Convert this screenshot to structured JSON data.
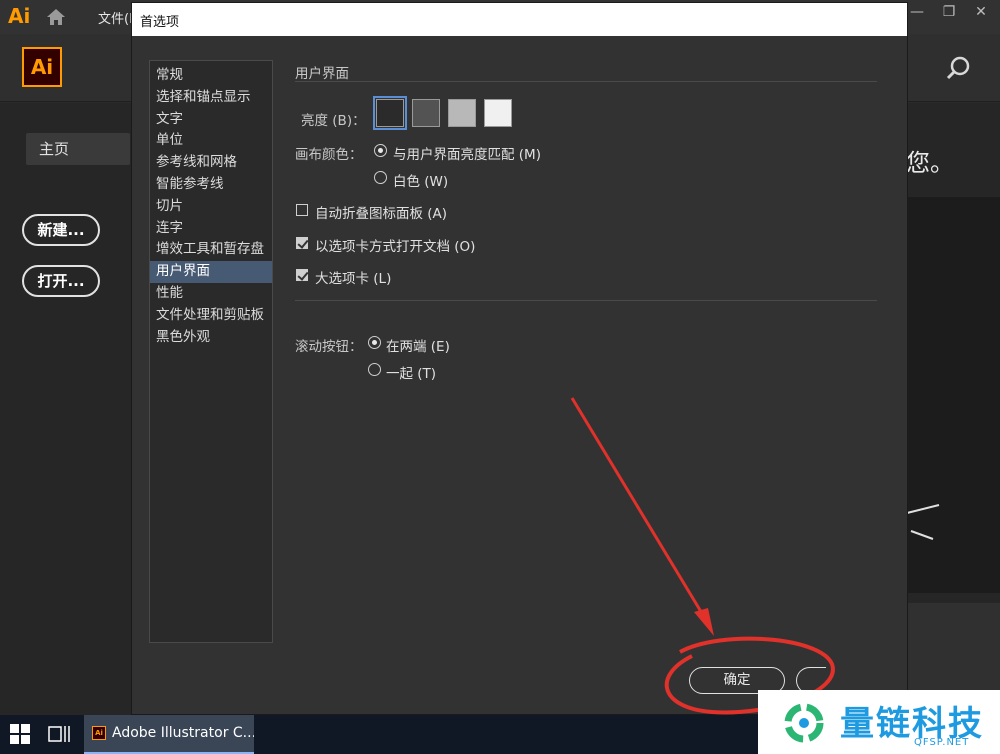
{
  "app": {
    "small_logo": "Ai",
    "menu_file": "文件(F)",
    "logo": "Ai",
    "home_tab": "主页",
    "new_button": "新建...",
    "open_button": "打开...",
    "right_partial_text": "您。"
  },
  "dialog": {
    "title": "首选项",
    "categories": [
      "常规",
      "选择和锚点显示",
      "文字",
      "单位",
      "参考线和网格",
      "智能参考线",
      "切片",
      "连字",
      "增效工具和暂存盘",
      "用户界面",
      "性能",
      "文件处理和剪贴板",
      "黑色外观"
    ],
    "selected_category": "用户界面",
    "section_title": "用户界面",
    "brightness_label": "亮度 (B)：",
    "brightness_swatches": [
      "#2b2b2b",
      "#535353",
      "#b8b8b8",
      "#f0f0f0"
    ],
    "canvas_color_label": "画布颜色：",
    "canvas_option_match": "与用户界面亮度匹配 (M)",
    "canvas_option_white": "白色 (W)",
    "auto_collapse": "自动折叠图标面板 (A)",
    "open_as_tabs": "以选项卡方式打开文档 (O)",
    "large_tabs": "大选项卡 (L)",
    "scroll_label": "滚动按钮：",
    "scroll_option_ends": "在两端 (E)",
    "scroll_option_together": "一起 (T)",
    "ok_button": "确定",
    "auto_collapse_checked": false,
    "open_as_tabs_checked": true,
    "large_tabs_checked": true
  },
  "taskbar": {
    "app_label": "Adobe Illustrator C..."
  },
  "watermark": {
    "text": "量链科技",
    "sub": "QFSP.NET"
  },
  "colors": {
    "accent_orange": "#ff9a00",
    "selection_blue": "#465a73",
    "annotation_red": "#e0312b",
    "watermark_blue": "#1e9be0"
  }
}
